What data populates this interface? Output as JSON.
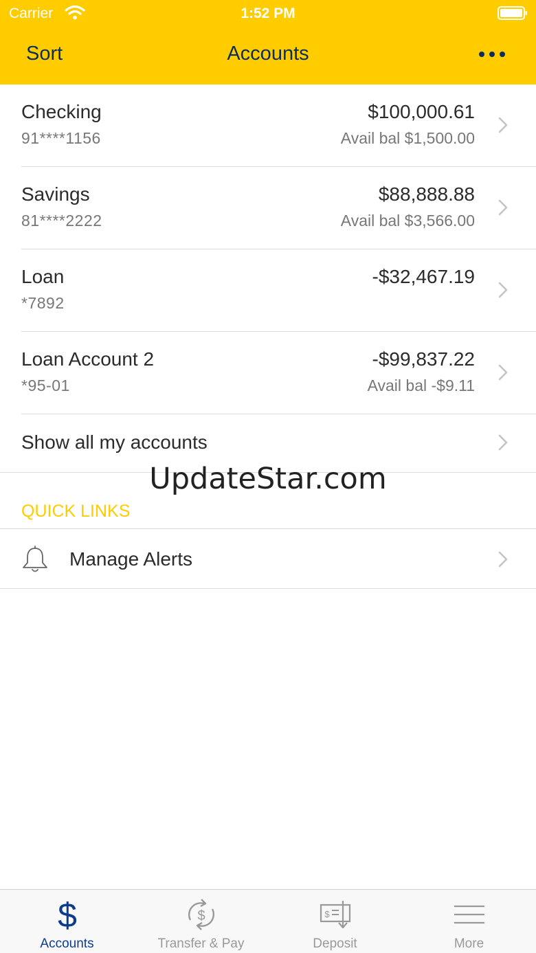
{
  "status_bar": {
    "carrier": "Carrier",
    "time": "1:52 PM"
  },
  "nav": {
    "sort_label": "Sort",
    "title": "Accounts",
    "more_icon": "more-dots-icon"
  },
  "accounts": [
    {
      "name": "Checking",
      "number": "91****1156",
      "balance": "$100,000.61",
      "avail": "Avail bal $1,500.00"
    },
    {
      "name": "Savings",
      "number": "81****2222",
      "balance": "$88,888.88",
      "avail": "Avail bal $3,566.00"
    },
    {
      "name": "Loan",
      "number": "*7892",
      "balance": "-$32,467.19",
      "avail": ""
    },
    {
      "name": "Loan Account 2",
      "number": "*95-01",
      "balance": "-$99,837.22",
      "avail": "Avail bal -$9.11"
    }
  ],
  "show_all": "Show all my accounts",
  "watermark": "UpdateStar.com",
  "quick_links": {
    "heading": "QUICK LINKS",
    "items": [
      {
        "label": "Manage Alerts",
        "icon": "bell-icon"
      }
    ]
  },
  "tabs": [
    {
      "label": "Accounts",
      "icon": "dollar-icon",
      "active": true
    },
    {
      "label": "Transfer & Pay",
      "icon": "transfer-icon",
      "active": false
    },
    {
      "label": "Deposit",
      "icon": "check-deposit-icon",
      "active": false
    },
    {
      "label": "More",
      "icon": "hamburger-menu-icon",
      "active": false
    }
  ],
  "colors": {
    "brand_yellow": "#FFCC00",
    "nav_text": "#0C2D5C",
    "tab_active": "#0C3D8C",
    "tab_inactive": "#999999"
  }
}
